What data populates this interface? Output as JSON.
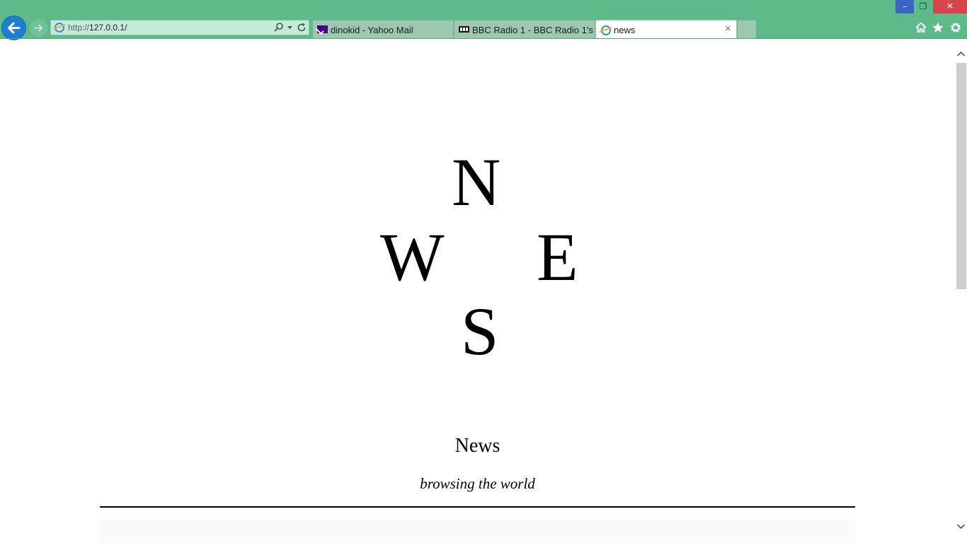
{
  "window": {
    "min_glyph": "–",
    "restore_glyph": "❐",
    "close_glyph": "✕"
  },
  "toolbar": {
    "url_scheme": "http://",
    "url_host": "127.0.0.1/"
  },
  "tabs": [
    {
      "label": "dinokid - Yahoo Mail",
      "icon": "yahoo-mail-icon"
    },
    {
      "label": "BBC Radio 1 - BBC Radio 1's ...",
      "icon": "bbc-icon"
    },
    {
      "label": "news",
      "icon": "ie-icon",
      "active": true
    }
  ],
  "tab_close_glyph": "×",
  "page": {
    "compass": {
      "n": "N",
      "w": "W",
      "e": "E",
      "s": "S"
    },
    "title": "News",
    "tagline": "browsing the world"
  },
  "colors": {
    "chrome": "#5dbb8a",
    "back_button": "#1e7fd0",
    "close_button": "#d9444a",
    "minimize_button": "#3a63c6"
  }
}
